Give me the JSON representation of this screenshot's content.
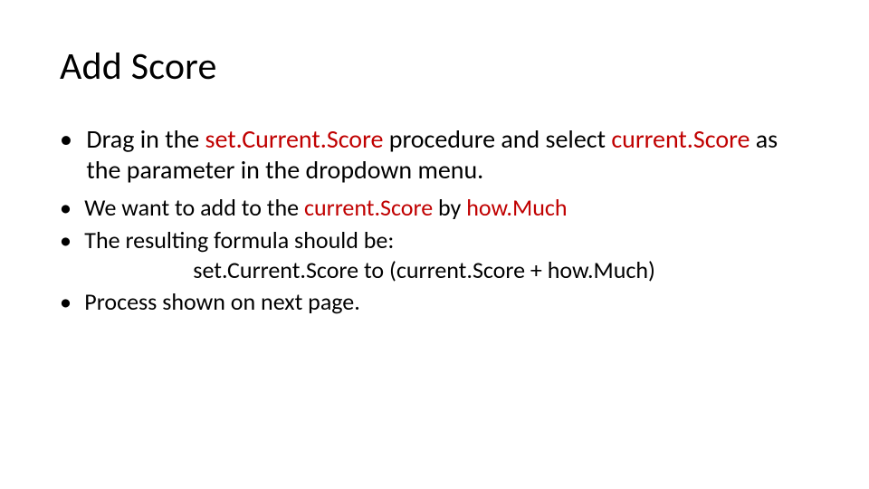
{
  "slide": {
    "title": "Add Score",
    "bullets": {
      "main": {
        "pre": "Drag in the ",
        "kw1": "set.Current.Score",
        "mid1": " procedure and select ",
        "kw2": "current.Score",
        "post": " as the parameter in the dropdown menu."
      },
      "sub1": {
        "pre": "We want to add to the ",
        "kw1": "current.Score",
        "mid": " by ",
        "kw2": "how.Much"
      },
      "sub2_line1": "The resulting formula should be:",
      "sub2_line2": "set.Current.Score to (current.Score + how.Much)",
      "sub3": "Process shown on next page."
    }
  },
  "glyphs": {
    "bullet": "•"
  }
}
